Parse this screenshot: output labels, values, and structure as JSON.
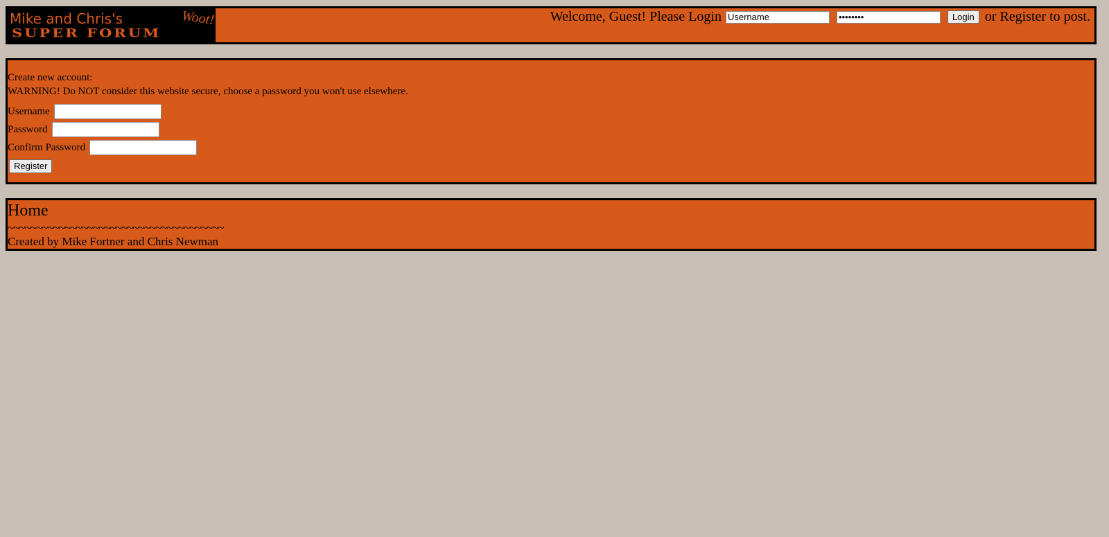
{
  "header": {
    "logo": {
      "line1": "Mike and Chris's",
      "line2": "SUPER FORUM",
      "woot": "Woot!"
    },
    "welcome_text": "Welcome, Guest! Please Login",
    "username_value": "Username",
    "password_value": "password",
    "login_label": "Login",
    "or_text": "or",
    "register_link": "Register",
    "tail_text": "to post."
  },
  "register_form": {
    "heading": "Create new account:",
    "warning": "WARNING! Do NOT consider this website secure, choose a password you won't use elsewhere.",
    "username_label": "Username",
    "password_label": "Password",
    "confirm_label": "Confirm Password",
    "submit_label": "Register"
  },
  "footer": {
    "title": "Home",
    "divider": "~~~~~~~~~~~~~~~~~~~~~~~~~~~~~~~~~~~~~~",
    "credits": "Created by Mike Fortner and Chris Newman"
  },
  "colors": {
    "page_background": "#c8c0b6",
    "panel_background": "#d75a1b",
    "panel_border": "#000000",
    "logo_background": "#000000",
    "logo_text": "#d75a1b"
  }
}
